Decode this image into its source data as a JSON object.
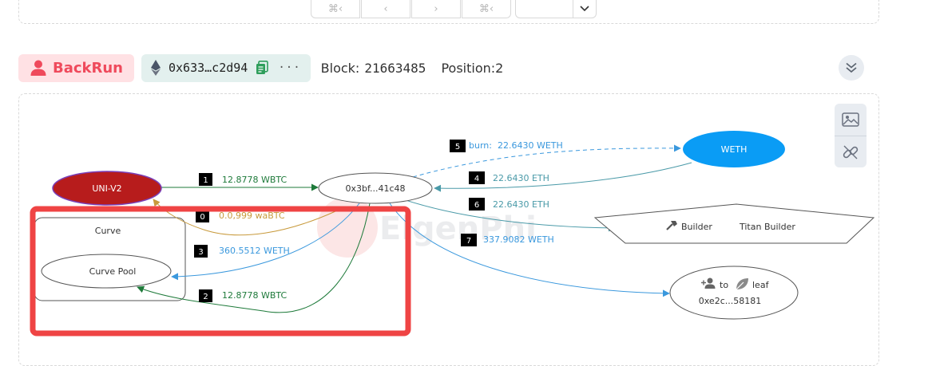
{
  "header": {
    "type_label": "BackRun",
    "tx_hash": "0x633…c2d94",
    "more_label": "···",
    "block_label": "Block:",
    "block_value": "21663485",
    "position_label": "Position:",
    "position_value": "2"
  },
  "graph": {
    "nodes": {
      "uni_v2": "UNI-V2",
      "sender": "0x3bf...41c48",
      "weth": "WETH",
      "builder_label": "Builder",
      "builder_name": "Titan Builder",
      "curve_cluster": "Curve",
      "curve_pool": "Curve Pool",
      "to_label": "to",
      "leaf_label": "leaf",
      "leaf_addr": "0xe2c...58181",
      "watermark": "EigenPhi"
    },
    "edges": [
      {
        "index": "1",
        "label": "12.8778 WBTC"
      },
      {
        "index": "0",
        "label": "0.0,999 waBTC"
      },
      {
        "index": "3",
        "label": "360.5512 WETH"
      },
      {
        "index": "2",
        "label": "12.8778 WBTC"
      },
      {
        "index": "5",
        "label": "burn:  22.6430 WETH"
      },
      {
        "index": "4",
        "label": "22.6430 ETH"
      },
      {
        "index": "6",
        "label": "22.6430 ETH"
      },
      {
        "index": "7",
        "label": "337.9082 WETH"
      }
    ]
  },
  "colors": {
    "backrun": "#ef4a5c",
    "uni_v2_fill": "#b71c1c",
    "weth_fill": "#0a9cf5",
    "edge_green": "#1e7a3a",
    "edge_gold": "#c89a3c",
    "edge_blue": "#3a98dd",
    "edge_teal": "#4a9aa8",
    "highlight": "#ef4444"
  }
}
